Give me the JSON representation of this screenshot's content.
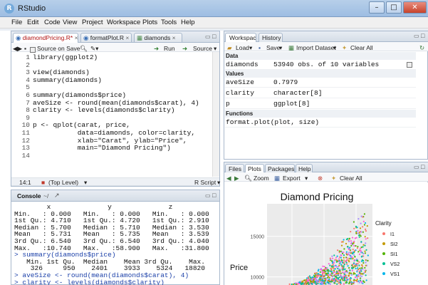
{
  "window": {
    "title": "RStudio",
    "app_icon": "R"
  },
  "menu": [
    "File",
    "Edit",
    "Code",
    "View",
    "Project",
    "Workspace",
    "Plots",
    "Tools",
    "Help"
  ],
  "editor": {
    "tabs": [
      "diamondPricing.R*",
      "formatPlot.R",
      "diamonds"
    ],
    "toolbar": {
      "source_on_save": "Source on Save",
      "run": "Run",
      "source": "Source"
    },
    "lines": [
      "library(ggplot2)",
      "",
      "view(diamonds)",
      "summary(diamonds)",
      "",
      "summary(diamonds$price)",
      "aveSize <- round(mean(diamonds$carat), 4)",
      "clarity <- levels(diamonds$clarity)",
      "",
      "p <- qplot(carat, price,",
      "           data=diamonds, color=clarity,",
      "           xlab=\"Carat\", ylab=\"Price\",",
      "           main=\"Diamond Pricing\")",
      ""
    ],
    "status": {
      "position": "14:1",
      "scope": "(Top Level)",
      "filetype": "R Script"
    }
  },
  "console": {
    "title": "Console",
    "path": "~/",
    "lines": [
      {
        "text": "        x              y              z",
        "cmd": false
      },
      {
        "text": "Min.   : 0.000   Min.   : 0.000   Min.   : 0.000",
        "cmd": false
      },
      {
        "text": "1st Qu.: 4.710   1st Qu.: 4.720   1st Qu.: 2.910",
        "cmd": false
      },
      {
        "text": "Median : 5.700   Median : 5.710   Median : 3.530",
        "cmd": false
      },
      {
        "text": "Mean   : 5.731   Mean   : 5.735   Mean   : 3.539",
        "cmd": false
      },
      {
        "text": "3rd Qu.: 6.540   3rd Qu.: 6.540   3rd Qu.: 4.040",
        "cmd": false
      },
      {
        "text": "Max.   :10.740   Max.   :58.900   Max.   :31.800",
        "cmd": false
      },
      {
        "text": "> summary(diamonds$price)",
        "cmd": true
      },
      {
        "text": "   Min. 1st Qu.  Median    Mean 3rd Qu.    Max.",
        "cmd": false
      },
      {
        "text": "    326     950    2401    3933    5324   18820",
        "cmd": false
      },
      {
        "text": "> aveSize <- round(mean(diamonds$carat), 4)",
        "cmd": true
      },
      {
        "text": "> clarity <- levels(diamonds$clarity)",
        "cmd": true
      }
    ]
  },
  "workspace": {
    "tabs": [
      "Workspace",
      "History"
    ],
    "toolbar": {
      "load": "Load",
      "save": "Save",
      "import": "Import Dataset",
      "clear": "Clear All"
    },
    "sections": {
      "data": "Data",
      "values": "Values",
      "functions": "Functions"
    },
    "data_rows": [
      {
        "name": "diamonds",
        "value": "53940 obs. of 10 variables"
      }
    ],
    "value_rows": [
      {
        "name": "aveSize",
        "value": "0.7979"
      },
      {
        "name": "clarity",
        "value": "character[8]"
      },
      {
        "name": "p",
        "value": "ggplot[8]"
      }
    ],
    "function_rows": [
      {
        "name": "format.plot(plot, size)",
        "value": ""
      }
    ]
  },
  "files": {
    "tabs": [
      "Files",
      "Plots",
      "Packages",
      "Help"
    ],
    "toolbar": {
      "zoom": "Zoom",
      "export": "Export",
      "clear": "Clear All"
    }
  },
  "colors": {
    "legend": [
      "#f8766d",
      "#c49a00",
      "#53b400",
      "#00c094",
      "#00b6eb",
      "#a58aff",
      "#fb61d7"
    ]
  },
  "chart_data": {
    "type": "scatter",
    "title": "Diamond Pricing",
    "ylabel": "Price",
    "yticks": [
      10000,
      15000
    ],
    "ytick_labels": [
      "10000",
      "15000"
    ],
    "ylim": [
      9000,
      19000
    ],
    "legend_title": "Clarity",
    "legend": [
      "I1",
      "SI2",
      "SI1",
      "VS2",
      "VS1"
    ]
  }
}
